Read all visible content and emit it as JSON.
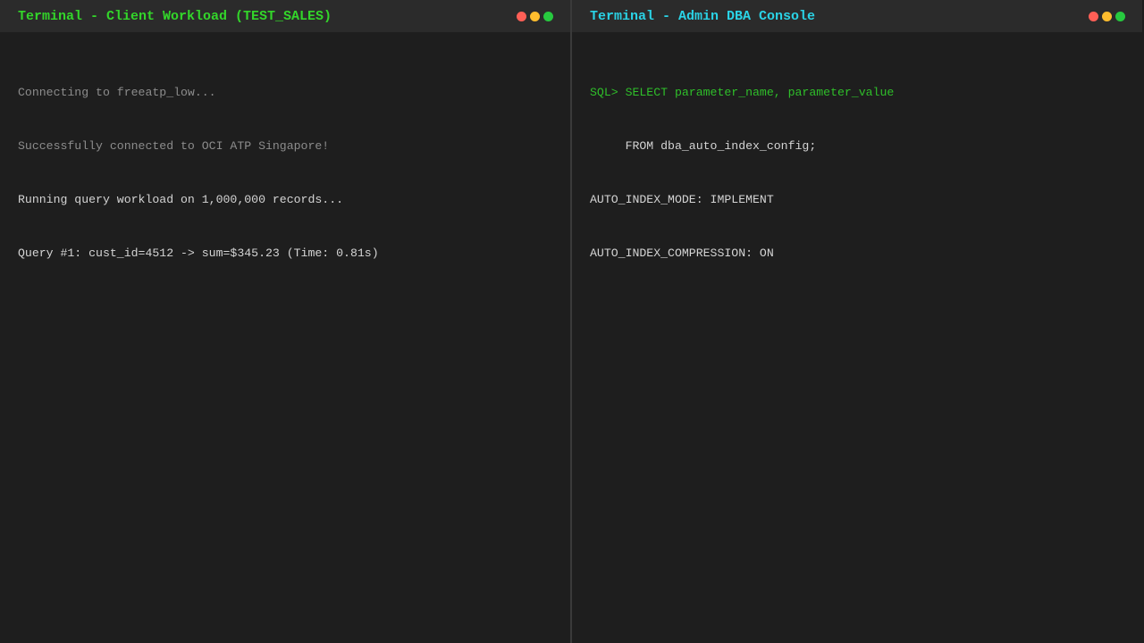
{
  "left_terminal": {
    "title": "Terminal - Client Workload (TEST_SALES)",
    "lines": [
      "Connecting to freeatp_low...",
      "Successfully connected to OCI ATP Singapore!",
      "Running query workload on 1,000,000 records...",
      "Query #1: cust_id=4512 -> sum=$345.23 (Time: 0.81s)"
    ]
  },
  "right_terminal": {
    "title": "Terminal - Admin DBA Console",
    "lines": [
      "SQL> SELECT parameter_name, parameter_value",
      "     FROM dba_auto_index_config;",
      "AUTO_INDEX_MODE: IMPLEMENT",
      "AUTO_INDEX_COMPRESSION: ON"
    ]
  },
  "colors": {
    "background": "#1e1e1e",
    "titlebar": "#2b2b2b",
    "left_title": "#33d62a",
    "right_title": "#2ad3e6",
    "sql_prompt": "#2fbf2a",
    "dim_text": "#8c8c8c",
    "bright_text": "#d4d4d4"
  }
}
